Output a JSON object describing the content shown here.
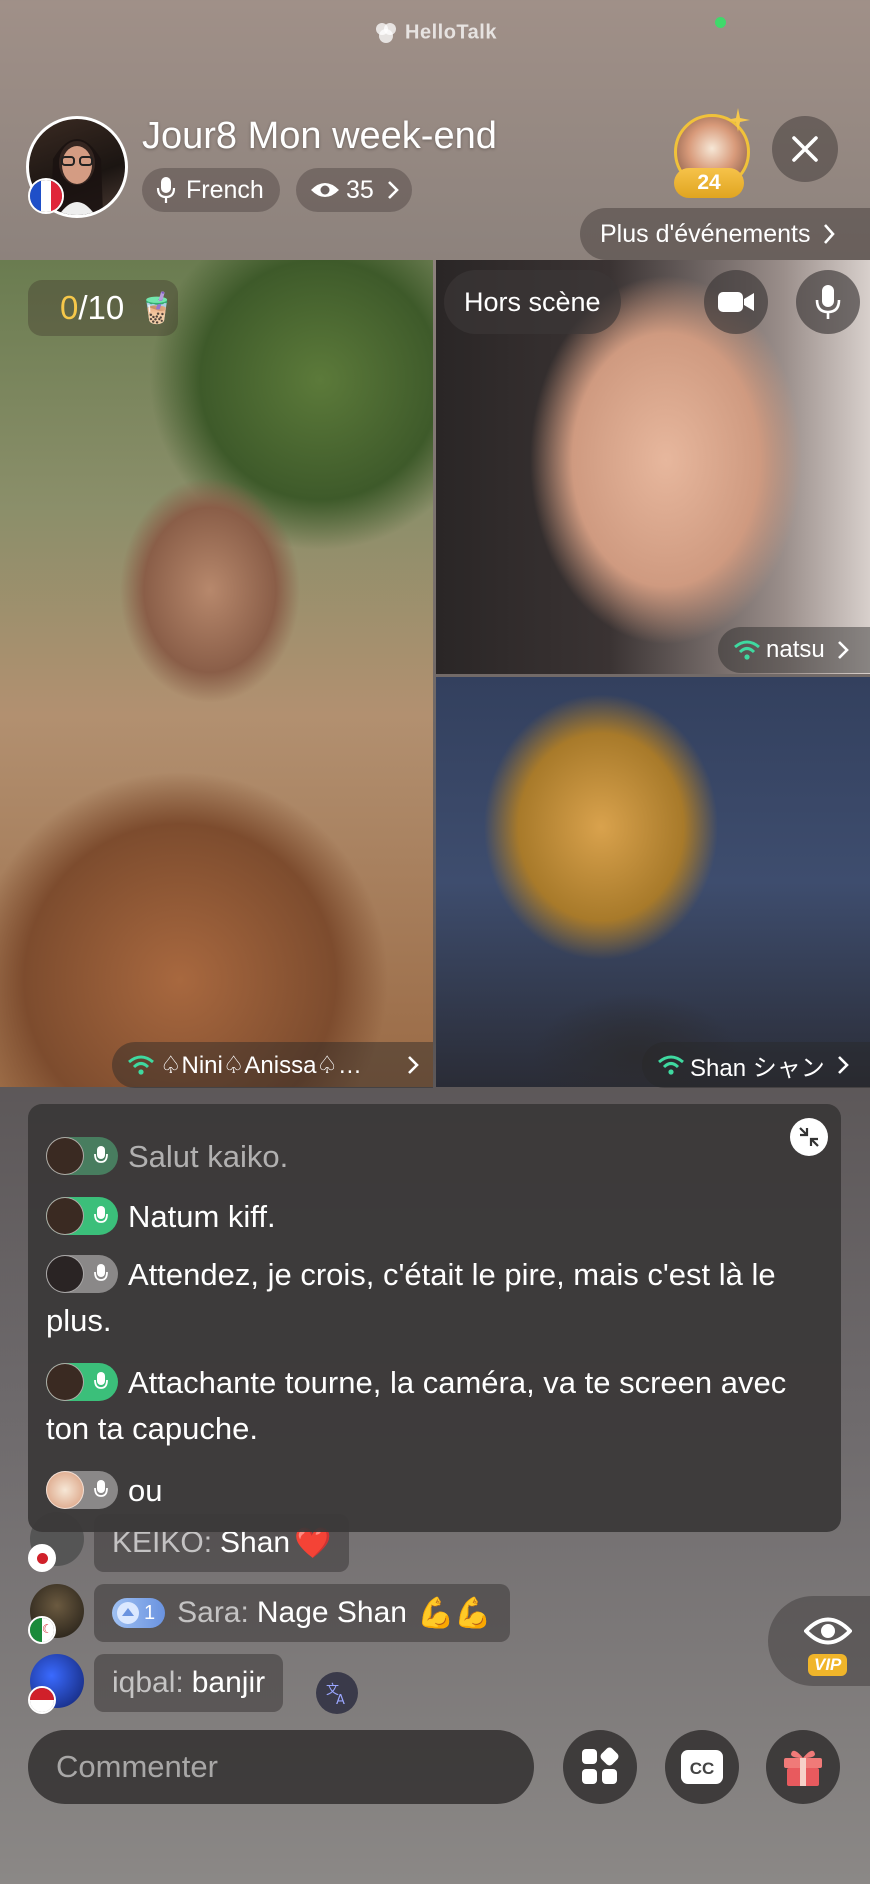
{
  "app": {
    "brand": "HelloTalk"
  },
  "header": {
    "title": "Jour8 Mon week-end",
    "language": "French",
    "viewers": "35",
    "badge_count": "24",
    "more_events": "Plus d'événements"
  },
  "stage": {
    "seat_counter_current": "0",
    "seat_counter_total": "/10",
    "offstage_label": "Hors scène",
    "participants": [
      {
        "name": "♤Nini♤Anissa♤…"
      },
      {
        "name": "natsu"
      },
      {
        "name": "Shan シャン"
      }
    ]
  },
  "transcript": {
    "lines": [
      {
        "text": "Salut kaiko."
      },
      {
        "text": "Natum kiff."
      },
      {
        "text": "Attendez, je crois, c'était le pire, mais c'est là le plus."
      },
      {
        "text": "Attachante tourne, la caméra, va te screen avec ton ta capuche."
      },
      {
        "text": "ou"
      }
    ]
  },
  "chat": {
    "messages": [
      {
        "user": "KEIKO:",
        "text": "Shan",
        "emoji": "❤️"
      },
      {
        "user": "Sara:",
        "text": "Nage Shan",
        "emoji": "💪💪",
        "level": "1"
      },
      {
        "user": "iqbal:",
        "text": "banjir"
      }
    ]
  },
  "vip_label": "VIP",
  "bottom_bar": {
    "comment_placeholder": "Commenter",
    "cc_label": "CC"
  },
  "colors": {
    "accent_gold": "#f6c84a",
    "wifi_green": "#3fd9a0",
    "live_dot": "#3fd96b"
  }
}
